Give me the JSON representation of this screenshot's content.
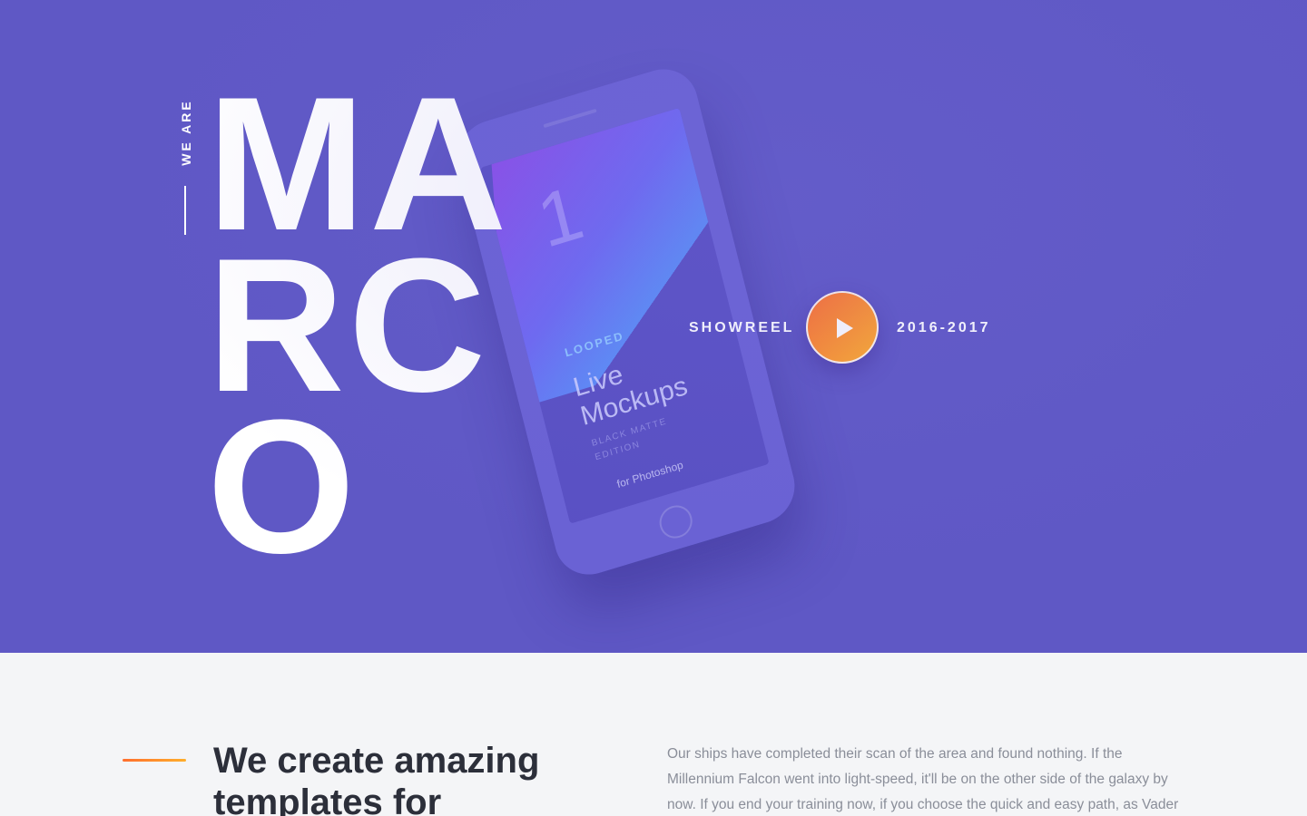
{
  "hero": {
    "eyebrow": "WE ARE",
    "big_word": "MA\nRC\nO",
    "background_color": "#5f58c5"
  },
  "mockup": {
    "screen_number": "1",
    "brand": "LOOPED",
    "title": "Live\nMockups",
    "edition": "BLACK MATTE\nEDITION",
    "tagline": "for Photoshop"
  },
  "showreel": {
    "label": "SHOWREEL",
    "years": "2016-2017",
    "play_icon": "play-icon",
    "accent_color": "#ff8a2c"
  },
  "about": {
    "title": "We create amazing templates for",
    "text": "Our ships have completed their scan of the area and found nothing. If the Millennium Falcon went into light-speed, it'll be on the other side of the galaxy by now. If you end your training now, if you choose the quick and easy path, as Vader"
  }
}
